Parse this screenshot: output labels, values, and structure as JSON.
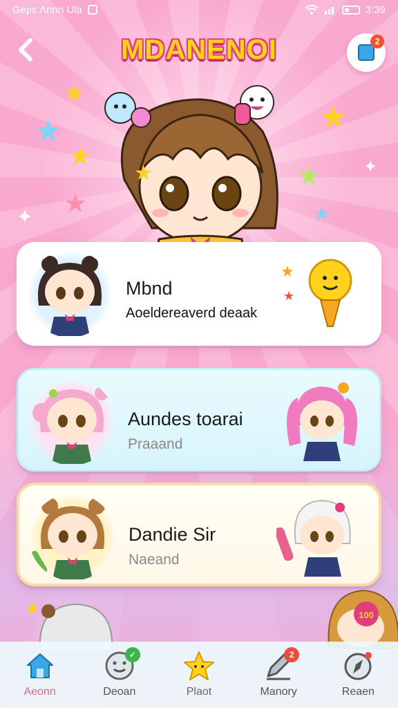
{
  "status_bar": {
    "left_text": "Geɟis Ʌnnn Ula",
    "time": "3:39"
  },
  "header": {
    "title": "MDANENOI",
    "back_icon": "chevron-left-icon",
    "message_badge": "2"
  },
  "cards": [
    {
      "name": "Mbnd",
      "subtitle": "Aoeldereaverd deaak",
      "avatar_icon": "chibi-girl-dark-hair",
      "deco_icon": "smiling-torch-mascot"
    },
    {
      "name": "Aundes toarai",
      "subtitle": "Praaand",
      "avatar_icon": "chibi-girl-pink-hair",
      "deco_icon": "chibi-girl-pink-twintails"
    },
    {
      "name": "Dandie Sir",
      "subtitle": "Naeand",
      "avatar_icon": "chibi-girl-brown-hair",
      "deco_icon": "chibi-girl-white-hair"
    }
  ],
  "peek_badge": "100",
  "tabs": [
    {
      "label": "Aeonn",
      "icon": "home-icon",
      "active": true
    },
    {
      "label": "Deoan",
      "icon": "smiley-icon",
      "badge": "✓",
      "badge_color": "#39b54a"
    },
    {
      "label": "Plaot",
      "icon": "star-icon"
    },
    {
      "label": "Manory",
      "icon": "pencil-icon",
      "badge": "2",
      "badge_color": "#ef4d3c"
    },
    {
      "label": "Reaen",
      "icon": "compass-icon",
      "badge": "",
      "badge_color": "#ef4d3c"
    }
  ],
  "colors": {
    "title_fill": "#ffd21e",
    "title_outline": "#e23d7a",
    "accent_pink": "#e8608f",
    "tab_home_blue": "#3aa6e6"
  }
}
